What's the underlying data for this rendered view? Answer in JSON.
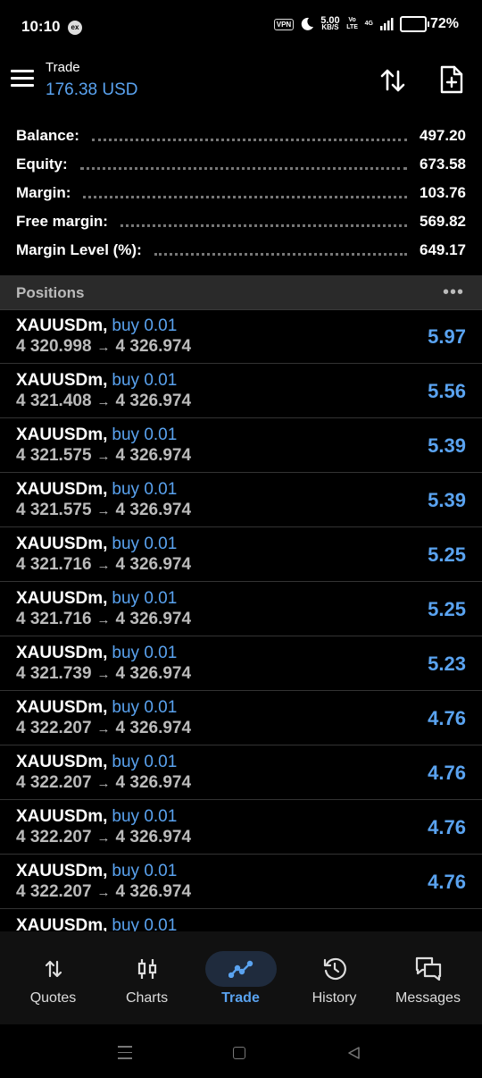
{
  "status_bar": {
    "time": "10:10",
    "ex_badge": "ex",
    "vpn": "VPN",
    "speed_value": "5.00",
    "speed_unit": "KB/S",
    "volte": "Vo LTE",
    "network": "4G",
    "battery_percent": "72%",
    "battery_level": 0.72
  },
  "header": {
    "title": "Trade",
    "balance": "176.38 USD",
    "icons": [
      "menu-icon",
      "sort-arrows-icon",
      "new-order-icon"
    ]
  },
  "summary": [
    {
      "label": "Balance:",
      "value": "497.20"
    },
    {
      "label": "Equity:",
      "value": "673.58"
    },
    {
      "label": "Margin:",
      "value": "103.76"
    },
    {
      "label": "Free margin:",
      "value": "569.82"
    },
    {
      "label": "Margin Level (%):",
      "value": "649.17"
    }
  ],
  "positions_header": {
    "label": "Positions",
    "more": "•••"
  },
  "positions": [
    {
      "symbol": "XAUUSDm,",
      "direction": "buy 0.01",
      "open": "4 320.998",
      "current": "4 326.974",
      "profit": "5.97"
    },
    {
      "symbol": "XAUUSDm,",
      "direction": "buy 0.01",
      "open": "4 321.408",
      "current": "4 326.974",
      "profit": "5.56"
    },
    {
      "symbol": "XAUUSDm,",
      "direction": "buy 0.01",
      "open": "4 321.575",
      "current": "4 326.974",
      "profit": "5.39"
    },
    {
      "symbol": "XAUUSDm,",
      "direction": "buy 0.01",
      "open": "4 321.575",
      "current": "4 326.974",
      "profit": "5.39"
    },
    {
      "symbol": "XAUUSDm,",
      "direction": "buy 0.01",
      "open": "4 321.716",
      "current": "4 326.974",
      "profit": "5.25"
    },
    {
      "symbol": "XAUUSDm,",
      "direction": "buy 0.01",
      "open": "4 321.716",
      "current": "4 326.974",
      "profit": "5.25"
    },
    {
      "symbol": "XAUUSDm,",
      "direction": "buy 0.01",
      "open": "4 321.739",
      "current": "4 326.974",
      "profit": "5.23"
    },
    {
      "symbol": "XAUUSDm,",
      "direction": "buy 0.01",
      "open": "4 322.207",
      "current": "4 326.974",
      "profit": "4.76"
    },
    {
      "symbol": "XAUUSDm,",
      "direction": "buy 0.01",
      "open": "4 322.207",
      "current": "4 326.974",
      "profit": "4.76"
    },
    {
      "symbol": "XAUUSDm,",
      "direction": "buy 0.01",
      "open": "4 322.207",
      "current": "4 326.974",
      "profit": "4.76"
    },
    {
      "symbol": "XAUUSDm,",
      "direction": "buy 0.01",
      "open": "4 322.207",
      "current": "4 326.974",
      "profit": "4.76"
    },
    {
      "symbol": "XAUUSDm,",
      "direction": "buy 0.01",
      "open": "",
      "current": "",
      "profit": ""
    }
  ],
  "bottom_nav": [
    {
      "label": "Quotes",
      "icon": "quotes-icon",
      "active": false
    },
    {
      "label": "Charts",
      "icon": "candlestick-icon",
      "active": false
    },
    {
      "label": "Trade",
      "icon": "trade-trend-icon",
      "active": true
    },
    {
      "label": "History",
      "icon": "history-icon",
      "active": false
    },
    {
      "label": "Messages",
      "icon": "messages-icon",
      "active": false
    }
  ],
  "colors": {
    "accent": "#5aa3f0",
    "background": "#000000",
    "header_bar": "#2a2a2a",
    "battery": "#f4b400"
  }
}
